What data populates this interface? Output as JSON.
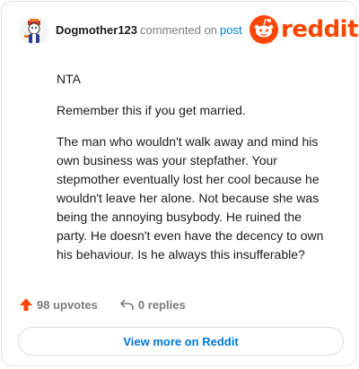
{
  "comment": {
    "username": "Dogmother123",
    "commented_on_text": "commented on",
    "post_link_text": "post",
    "paragraphs": [
      "NTA",
      "Remember this if you get married.",
      "The man who wouldn't walk away and mind his own business was your stepfather. Your stepmother eventually lost her cool because he wouldn't leave her alone. Not because she was being the annoying busybody. He ruined the party. He doesn't even have the decency to own his behaviour. Is he always this insufferable?"
    ]
  },
  "brand": {
    "wordmark": "reddit",
    "color": "#ff4500"
  },
  "actions": {
    "upvotes_label": "98 upvotes",
    "replies_label": "0 replies"
  },
  "footer": {
    "view_more_label": "View more on Reddit"
  },
  "icons": {
    "avatar": "user-avatar",
    "logo": "reddit-snoo-icon",
    "upvote": "upvote-arrow-icon",
    "reply": "reply-arrow-icon"
  },
  "colors": {
    "accent_blue": "#0079d3",
    "upvote_orange": "#ff4500",
    "muted_text": "#7c7c7c"
  }
}
